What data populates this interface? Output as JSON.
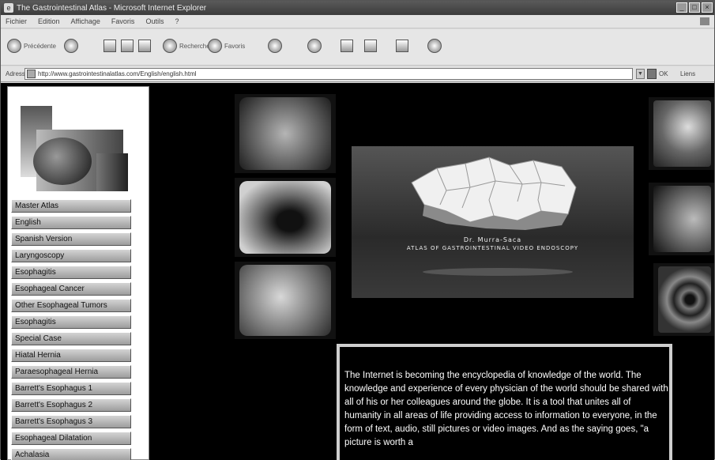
{
  "window": {
    "title": "The Gastrointestinal Atlas - Microsoft Internet Explorer",
    "controls": [
      "_",
      "□",
      "×"
    ]
  },
  "menubar": {
    "items": [
      "Fichier",
      "Edition",
      "Affichage",
      "Favoris",
      "Outils",
      "?"
    ]
  },
  "toolbar": {
    "back_label": "Précédente",
    "search_label": "Rechercher",
    "favorites_label": "Favoris"
  },
  "address": {
    "label": "Adresse",
    "url": "http://www.gastrointestinalatlas.com/English/english.html",
    "go_label": "OK",
    "links_label": "Liens"
  },
  "sidebar": {
    "items": [
      "Master Atlas",
      "English",
      "Spanish Version",
      "Laryngoscopy",
      "Esophagitis",
      "Esophageal Cancer",
      "Other Esophageal Tumors",
      "Esophagitis",
      "Special Case",
      "Hiatal Hernia",
      "Paraesophageal Hernia",
      "Barrett's Esophagus 1",
      "Barrett's Esophagus 2",
      "Barrett's Esophagus 3",
      "Esophageal Dilatation",
      "Achalasia"
    ]
  },
  "banner": {
    "line1": "Dr. Murra-Saca",
    "line2": "ATLAS OF GASTROINTESTINAL VIDEO ENDOSCOPY"
  },
  "intro": {
    "text": "The Internet is becoming the encyclopedia of knowledge of the world. The knowledge and experience of every physician of the world should be shared with all of his or her colleagues around the globe. It is a tool that unites all of humanity in all areas of life providing access to information to everyone, in the form of text, audio, still pictures or video images. And as the saying goes, \"a picture is worth a"
  },
  "colors": {
    "page_bg": "#000000",
    "sidebar_bg": "#ffffff",
    "text": "#ffffff",
    "button": "#b4b4b4"
  }
}
